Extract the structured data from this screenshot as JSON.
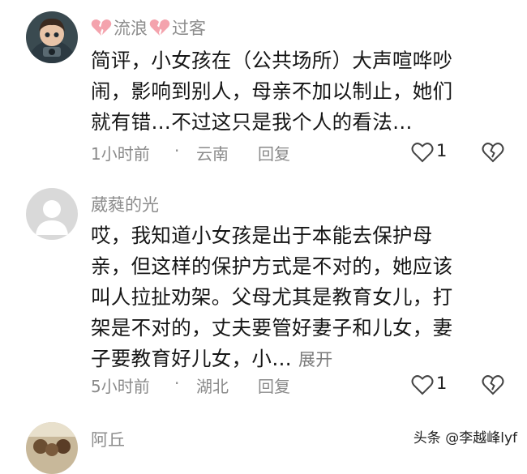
{
  "comments": [
    {
      "username_parts": [
        "流浪",
        "过客"
      ],
      "text_lines": [
        "简评，小女孩在（公共场所）大声喧哗吵",
        "闹，影响到别人，母亲不加以制止，她们",
        "就有错…不过这只是我个人的看法…"
      ],
      "time": "1小时前",
      "dot": "·",
      "location": "云南",
      "reply_label": "回复",
      "like_count": "1"
    },
    {
      "username": "葳蕤的光",
      "text_lines": [
        "哎，我知道小女孩是出于本能去保护母",
        "亲，但这样的保护方式是不对的，她应该",
        "叫人拉扯劝架。父母尤其是教育女儿，打",
        "架是不对的，丈夫要管好妻子和儿女，妻",
        "子要教育好儿女，小…"
      ],
      "expand_label": "展开",
      "time": "5小时前",
      "dot": "·",
      "location": "湖北",
      "reply_label": "回复",
      "like_count": "1"
    },
    {
      "username": "阿丘"
    }
  ],
  "icons": {
    "heart": "heart-outline-icon",
    "broken_heart": "broken-heart-icon",
    "dislike": "dislike-heart-icon"
  },
  "colors": {
    "username": "#8c8c8c",
    "meta": "#8a8a8a",
    "broken_heart": "#f4a3ad"
  },
  "watermark": "头条 @李越峰lyf"
}
